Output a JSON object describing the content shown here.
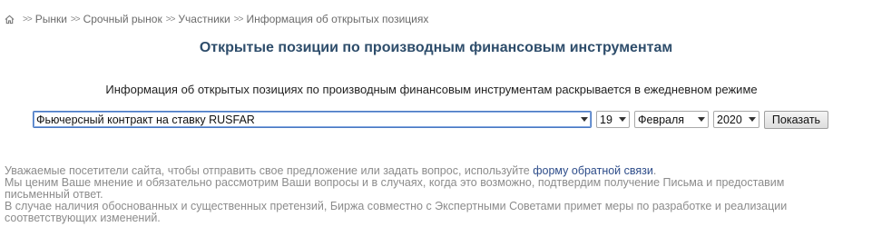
{
  "breadcrumb": {
    "items": [
      "Рынки",
      "Срочный рынок",
      "Участники"
    ],
    "current": "Информация об открытых позициях",
    "separator": ">>"
  },
  "title": "Открытые позиции по производным финансовым инструментам",
  "description": "Информация об открытых позициях по производным финансовым инструментам раскрывается в ежедневном режиме",
  "form": {
    "instrument": "Фьючерсный контракт на ставку RUSFAR",
    "day": "19",
    "month": "Февраля",
    "year": "2020",
    "submit_label": "Показать"
  },
  "notice": {
    "line1_prefix": "Уважаемые посетители сайта, чтобы отправить свое предложение или задать вопрос, используйте ",
    "line1_link": "форму обратной связи",
    "line1_suffix": ".",
    "line2": "Мы ценим Ваше мнение и обязательно рассмотрим Ваши вопросы и в случаях, когда это возможно, подтвердим получение Письма и предоставим письменный ответ.",
    "line3": "В случае наличия обоснованных и существенных претензий, Биржа совместно с Экспертными Советами примет меры по разработке и реализации соответствующих изменений."
  },
  "colors": {
    "title": "#2e4d6b",
    "link": "#2e4d8a",
    "muted": "#8c8c8c"
  }
}
